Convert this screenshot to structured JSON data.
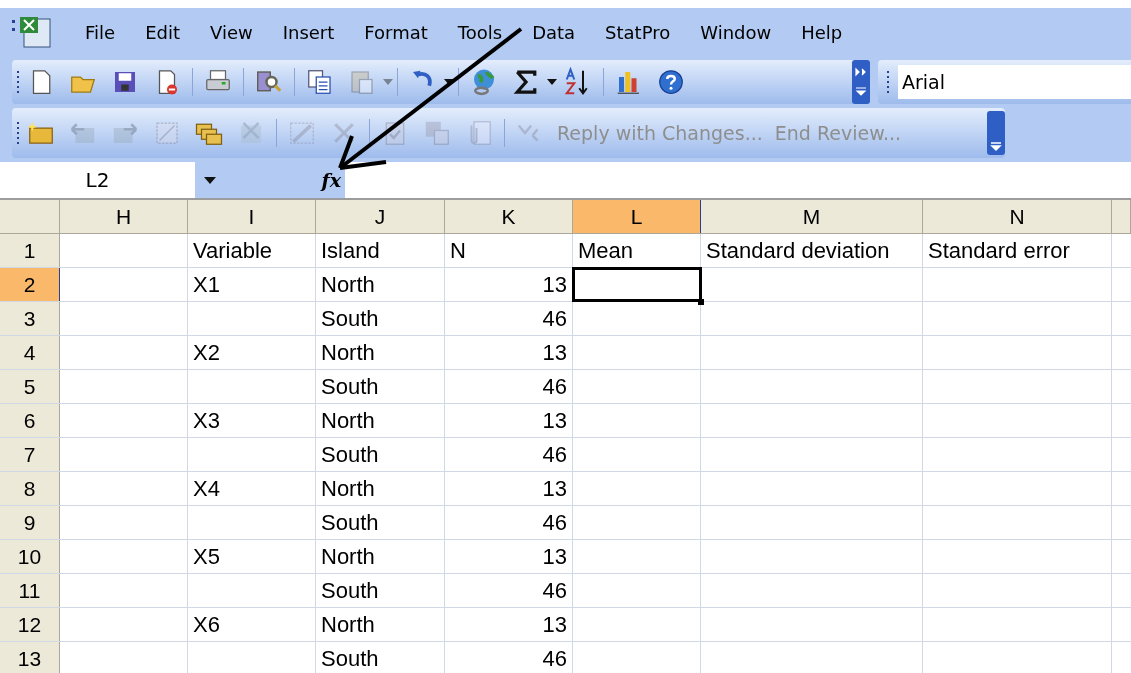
{
  "menu_bar": [
    "File",
    "Edit",
    "View",
    "Insert",
    "Format",
    "Tools",
    "Data",
    "StatPro",
    "Window",
    "Help"
  ],
  "font_box": {
    "value": "Arial"
  },
  "review_toolbar": [
    {
      "label": "Reply with Changes...",
      "disabled": true
    },
    {
      "label": "End Review...",
      "disabled": true
    }
  ],
  "formula_bar": {
    "name_box": "L2",
    "function_label": "fx"
  },
  "sheet": {
    "columns": [
      {
        "label": "H",
        "kind": "text",
        "selected": false
      },
      {
        "label": "I",
        "kind": "text",
        "selected": false
      },
      {
        "label": "J",
        "kind": "text",
        "selected": false
      },
      {
        "label": "K",
        "kind": "number",
        "selected": false
      },
      {
        "label": "L",
        "kind": "text",
        "selected": true
      },
      {
        "label": "M",
        "kind": "text",
        "selected": false
      },
      {
        "label": "N",
        "kind": "text",
        "selected": false
      }
    ],
    "rows": [
      {
        "header": "1",
        "selected": false,
        "cells": [
          "",
          "Variable",
          "Island",
          "N",
          "Mean",
          "Standard deviation",
          "Standard error"
        ]
      },
      {
        "header": "2",
        "selected": true,
        "cells": [
          "",
          "X1",
          "North",
          "13",
          "",
          "",
          ""
        ]
      },
      {
        "header": "3",
        "selected": false,
        "cells": [
          "",
          "",
          "South",
          "46",
          "",
          "",
          ""
        ]
      },
      {
        "header": "4",
        "selected": false,
        "cells": [
          "",
          "X2",
          "North",
          "13",
          "",
          "",
          ""
        ]
      },
      {
        "header": "5",
        "selected": false,
        "cells": [
          "",
          "",
          "South",
          "46",
          "",
          "",
          ""
        ]
      },
      {
        "header": "6",
        "selected": false,
        "cells": [
          "",
          "X3",
          "North",
          "13",
          "",
          "",
          ""
        ]
      },
      {
        "header": "7",
        "selected": false,
        "cells": [
          "",
          "",
          "South",
          "46",
          "",
          "",
          ""
        ]
      },
      {
        "header": "8",
        "selected": false,
        "cells": [
          "",
          "X4",
          "North",
          "13",
          "",
          "",
          ""
        ]
      },
      {
        "header": "9",
        "selected": false,
        "cells": [
          "",
          "",
          "South",
          "46",
          "",
          "",
          ""
        ]
      },
      {
        "header": "10",
        "selected": false,
        "cells": [
          "",
          "X5",
          "North",
          "13",
          "",
          "",
          ""
        ]
      },
      {
        "header": "11",
        "selected": false,
        "cells": [
          "",
          "",
          "South",
          "46",
          "",
          "",
          ""
        ]
      },
      {
        "header": "12",
        "selected": false,
        "cells": [
          "",
          "X6",
          "North",
          "13",
          "",
          "",
          ""
        ]
      },
      {
        "header": "13",
        "selected": false,
        "cells": [
          "",
          "",
          "South",
          "46",
          "",
          "",
          ""
        ]
      }
    ]
  }
}
